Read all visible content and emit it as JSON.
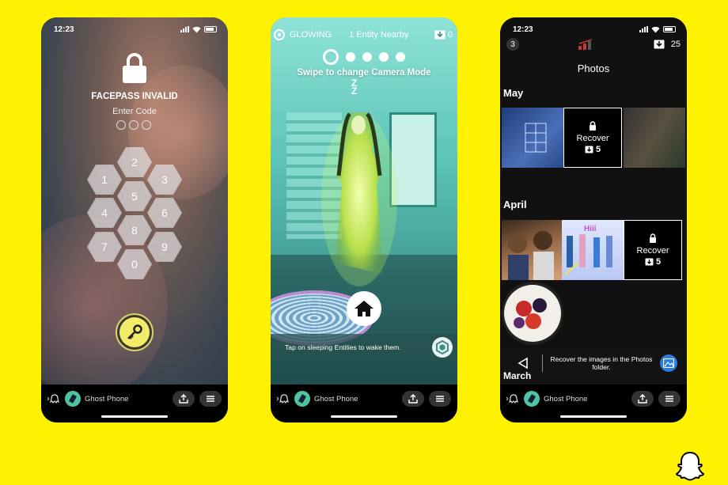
{
  "phones": [
    {
      "status": {
        "time": "12:23"
      },
      "lock": {
        "title": "FACEPASS INVALID",
        "subtitle": "Enter Code",
        "keys": [
          "2",
          "1",
          "3",
          "5",
          "4",
          "6",
          "8",
          "7",
          "9",
          "0"
        ]
      },
      "bottom": {
        "app_label": "Ghost Phone"
      }
    },
    {
      "header": {
        "mode": "GLOWING",
        "nearby": "1 Entity Nearby",
        "count": "0"
      },
      "swipe_hint": "Swipe to change Camera Mode",
      "sleep_mark": "Z\nZ",
      "tap_hint": "Tap on sleeping Entities to wake them.",
      "bottom": {
        "app_label": "Ghost Phone"
      }
    },
    {
      "status": {
        "time": "12:23"
      },
      "header": {
        "badge": "3",
        "count": "25"
      },
      "title": "Photos",
      "sections": [
        {
          "label": "May",
          "recover_label": "Recover",
          "recover_count": "5"
        },
        {
          "label": "April",
          "recover_label": "Recover",
          "recover_count": "5"
        },
        {
          "label": "March"
        }
      ],
      "toast": "Recover the images in the Photos folder.",
      "bottom": {
        "app_label": "Ghost Phone"
      }
    }
  ],
  "colors": {
    "background": "#FFF200",
    "accent_key": "#F3EC6B",
    "glow": "#6FD6C9"
  }
}
